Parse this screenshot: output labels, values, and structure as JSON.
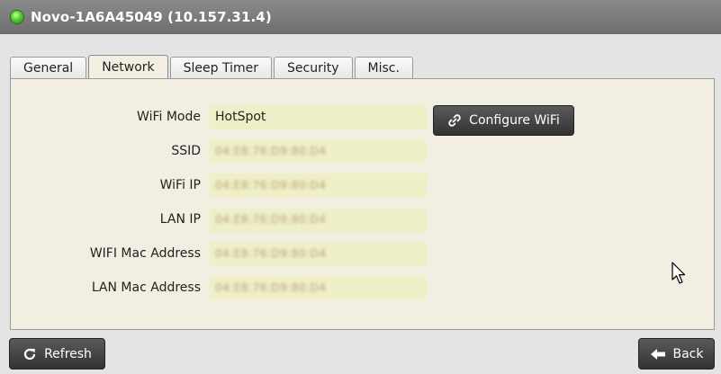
{
  "window": {
    "title": "Novo-1A6A45049 (10.157.31.4)",
    "status_color": "#4fce2a"
  },
  "tabs": [
    {
      "label": "General",
      "active": false
    },
    {
      "label": "Network",
      "active": true
    },
    {
      "label": "Sleep Timer",
      "active": false
    },
    {
      "label": "Security",
      "active": false
    },
    {
      "label": "Misc.",
      "active": false
    }
  ],
  "network": {
    "fields": [
      {
        "label": "WiFi Mode",
        "value": "HotSpot",
        "redacted": false
      },
      {
        "label": "SSID",
        "value": "04:E8:76:D9:80:D4",
        "redacted": true
      },
      {
        "label": "WiFi IP",
        "value": "04:E8:76:D9:80:D4",
        "redacted": true
      },
      {
        "label": "LAN IP",
        "value": "04:E8:76:D9:80:D4",
        "redacted": true
      },
      {
        "label": "WIFI Mac Address",
        "value": "04:E8:76:D9:80:D4",
        "redacted": true
      },
      {
        "label": "LAN Mac Address",
        "value": "04:E8:76:D9:80:D4",
        "redacted": true
      }
    ],
    "configure_button": {
      "label": "Configure WiFi",
      "icon": "link-icon"
    }
  },
  "footer": {
    "refresh_button": {
      "label": "Refresh",
      "icon": "refresh-icon"
    },
    "back_button": {
      "label": "Back",
      "icon": "arrow-left-icon"
    }
  }
}
